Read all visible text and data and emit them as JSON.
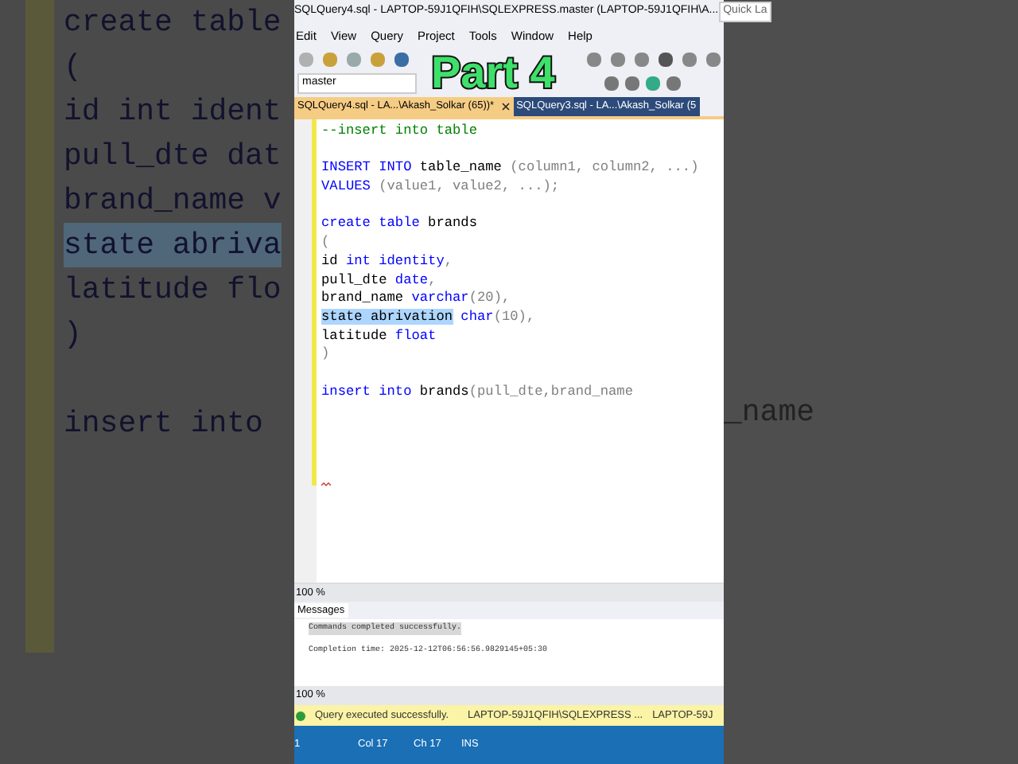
{
  "backdrop_left": {
    "lines": [
      {
        "text": "create table",
        "selected": false
      },
      {
        "text": "(",
        "selected": false
      },
      {
        "text": "id int ident",
        "selected": false
      },
      {
        "text": "pull_dte dat",
        "selected": false
      },
      {
        "text": "brand_name v",
        "selected": false
      },
      {
        "text": "state abriva",
        "selected": true
      },
      {
        "text": "latitude flo",
        "selected": false
      },
      {
        "text": ")",
        "selected": false
      },
      {
        "text": "insert into",
        "selected": false,
        "space_before": true
      }
    ]
  },
  "backdrop_right": {
    "lines": [
      {
        "text": "_name"
      }
    ]
  },
  "overlay_title": "Part 4",
  "window": {
    "title": "SQLQuery4.sql - LAPTOP-59J1QFIH\\SQLEXPRESS.master (LAPTOP-59J1QFIH\\A...",
    "quick_launch": "Quick La"
  },
  "menu": [
    "Edit",
    "View",
    "Query",
    "Project",
    "Tools",
    "Window",
    "Help"
  ],
  "database_select": {
    "value": "master"
  },
  "tabs": [
    {
      "label": "SQLQuery4.sql - LA...\\Akash_Solkar (65))*",
      "selected": true
    },
    {
      "label": "SQLQuery3.sql - LA...\\Akash_Solkar (5",
      "selected": false
    }
  ],
  "editor": {
    "lines": [
      [
        {
          "text": "--insert into table",
          "kind": "comment"
        }
      ],
      [
        {
          "text": "INSERT INTO",
          "kind": "keyword",
          "space_before": true
        },
        {
          "text": " table_name ",
          "kind": "plain"
        },
        {
          "text": "(column1, column2, ...)",
          "kind": "punct"
        }
      ],
      [
        {
          "text": "VALUES",
          "kind": "keyword"
        },
        {
          "text": " (value1, value2, ...);",
          "kind": "punct"
        }
      ],
      [
        {
          "text": "create table",
          "kind": "keyword",
          "space_before": true
        },
        {
          "text": " brands",
          "kind": "plain"
        }
      ],
      [
        {
          "text": "(",
          "kind": "punct"
        }
      ],
      [
        {
          "text": "id ",
          "kind": "plain"
        },
        {
          "text": "int identity",
          "kind": "keyword"
        },
        {
          "text": ",",
          "kind": "punct"
        }
      ],
      [
        {
          "text": "pull_dte ",
          "kind": "plain"
        },
        {
          "text": "date",
          "kind": "keyword"
        },
        {
          "text": ",",
          "kind": "punct"
        }
      ],
      [
        {
          "text": "brand_name ",
          "kind": "plain"
        },
        {
          "text": "varchar",
          "kind": "keyword"
        },
        {
          "text": "(20),",
          "kind": "punct"
        }
      ],
      [
        {
          "text": "state abrivation",
          "kind": "selected"
        },
        {
          "text": " char",
          "kind": "keyword"
        },
        {
          "text": "(10),",
          "kind": "punct"
        }
      ],
      [
        {
          "text": "latitude ",
          "kind": "plain"
        },
        {
          "text": "float",
          "kind": "keyword"
        }
      ],
      [
        {
          "text": ")",
          "kind": "punct"
        }
      ],
      [
        {
          "text": "insert into",
          "kind": "keyword",
          "space_before": true
        },
        {
          "text": " brands",
          "kind": "plain"
        },
        {
          "text": "(pull_dte,brand_name",
          "kind": "punct"
        }
      ]
    ]
  },
  "editor_zoom": "100 %",
  "results": {
    "tab": "Messages",
    "messages": [
      "Commands completed successfully.",
      "Completion time: 2025-12-12T06:56:56.9829145+05:30"
    ],
    "zoom": "100 %"
  },
  "status": {
    "message": "Query executed successfully.",
    "server": "LAPTOP-59J1QFIH\\SQLEXPRESS ...",
    "user": "LAPTOP-59J"
  },
  "status_bar": [
    "1",
    "Col 17",
    "Ch 17",
    "INS"
  ]
}
